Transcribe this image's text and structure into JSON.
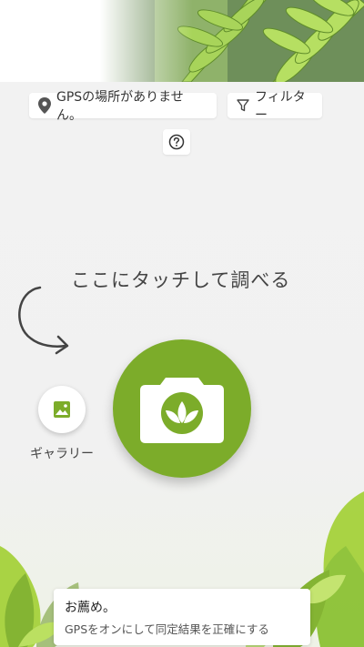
{
  "location": {
    "status_label": "GPSの場所がありません。",
    "icon": "location-pin-icon"
  },
  "filter": {
    "label": "フィルター",
    "icon": "filter-icon"
  },
  "help": {
    "icon": "help-icon"
  },
  "hint": {
    "text": "ここにタッチして調べる"
  },
  "gallery": {
    "label": "ギャラリー",
    "icon": "image-icon"
  },
  "camera": {
    "icon": "camera-leaf-icon"
  },
  "recommendation": {
    "title": "お薦め。",
    "text": "GPSをオンにして同定結果を正確にする"
  },
  "colors": {
    "accent": "#7cac2a",
    "leaf_light": "#9fd13a",
    "leaf_dark": "#4e7a1f",
    "text": "#333333"
  }
}
